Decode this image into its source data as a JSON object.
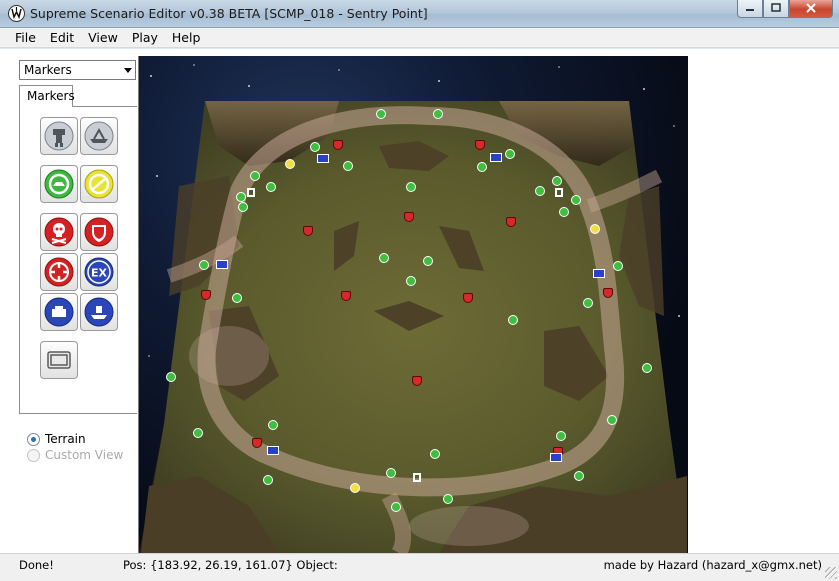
{
  "window": {
    "title": "Supreme Scenario Editor v0.38 BETA [SCMP_018 - Sentry Point]",
    "controls": [
      "minimize-icon",
      "maximize-icon",
      "close-icon"
    ]
  },
  "menu": {
    "items": [
      "File",
      "Edit",
      "View",
      "Play",
      "Help"
    ]
  },
  "left_panel": {
    "dropdown_value": "Markers",
    "tab_label": "Markers",
    "tools": [
      {
        "name": "land-unit-marker-icon",
        "color": "#9aa2aa"
      },
      {
        "name": "naval-unit-marker-icon",
        "color": "#9aa2aa"
      },
      {
        "name": "mass-resource-marker-icon",
        "color": "#3fb83f"
      },
      {
        "name": "hydro-resource-marker-icon",
        "color": "#e8e232"
      },
      {
        "name": "defense-point-marker-icon",
        "color": "#d42222"
      },
      {
        "name": "shield-marker-icon",
        "color": "#d42222"
      },
      {
        "name": "rally-point-marker-icon",
        "color": "#d42222"
      },
      {
        "name": "expansion-marker-icon",
        "color": "#2b46b8"
      },
      {
        "name": "naval-area-marker-icon",
        "color": "#2b46b8"
      },
      {
        "name": "naval-defense-marker-icon",
        "color": "#2b46b8"
      },
      {
        "name": "camera-info-marker-icon",
        "color": "#9aa2aa"
      }
    ],
    "view_mode": {
      "options": [
        {
          "label": "Terrain",
          "selected": true,
          "enabled": true
        },
        {
          "label": "Custom View",
          "selected": false,
          "enabled": false
        }
      ]
    }
  },
  "viewport": {
    "map_name": "Sentry Point",
    "terrain_color": "#5b5a2e",
    "path_color": "#c9a993",
    "marker_colors": {
      "mass": "#3fbf3f",
      "hydro": "#f0e040",
      "defense": "#d62a2a",
      "expansion": "#2841c8",
      "army": "#ffffff"
    }
  },
  "status": {
    "state": "Done!",
    "position": "Pos: {183.92, 26.19, 161.07} Object:",
    "credit": "made by Hazard (hazard_x@gmx.net)"
  }
}
